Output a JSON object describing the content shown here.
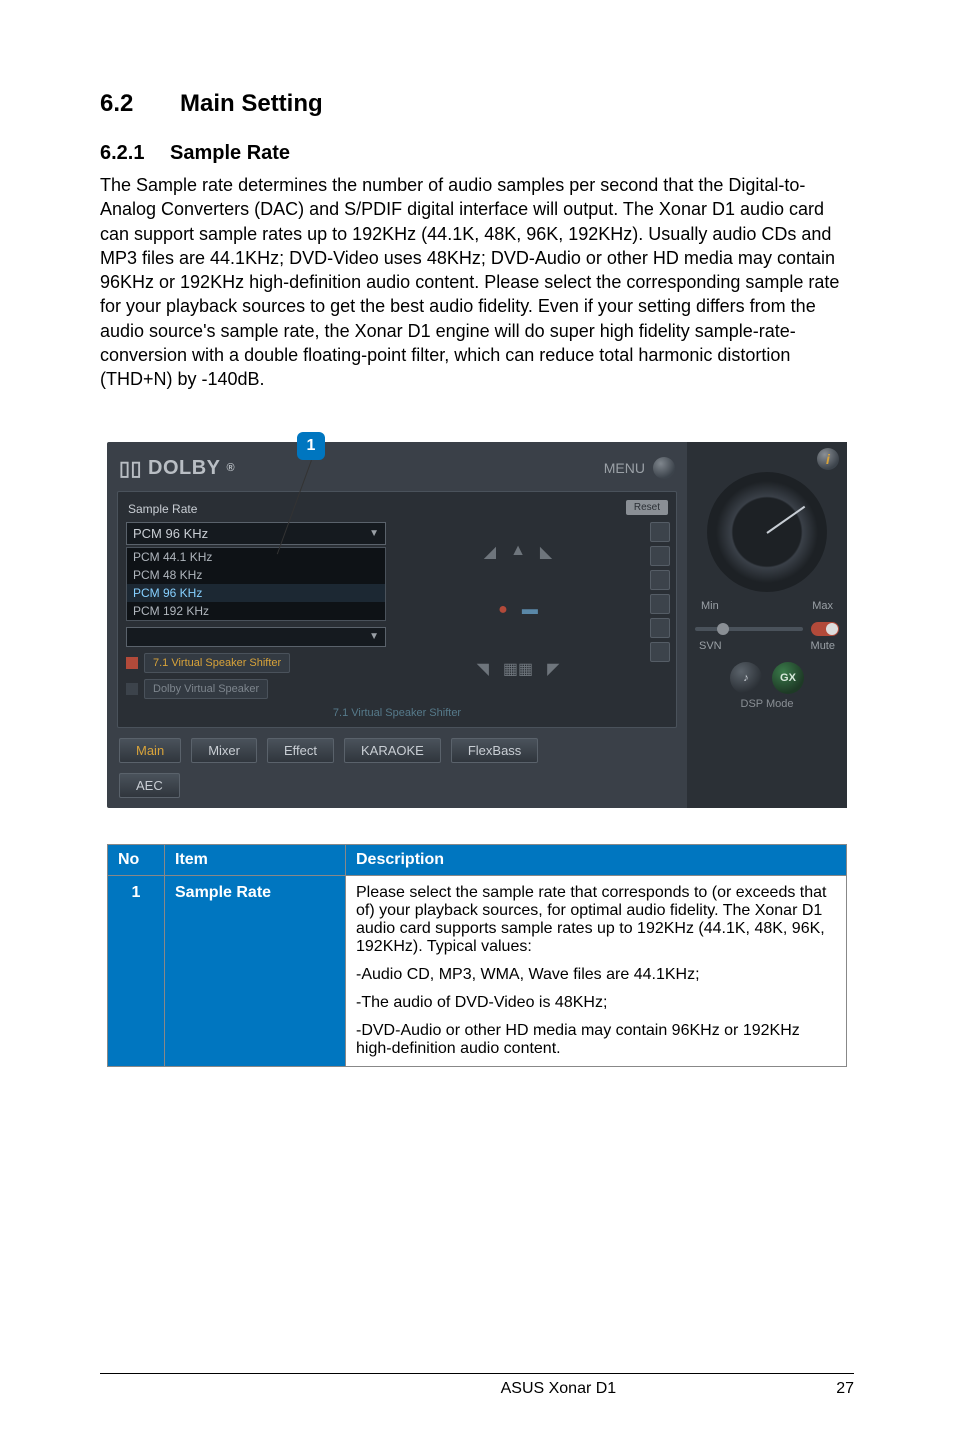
{
  "headings": {
    "h1_num": "6.2",
    "h1_title": "Main Setting",
    "h2_num": "6.2.1",
    "h2_title": "Sample Rate"
  },
  "paragraph": "The Sample rate determines the number of audio samples per second that the Digital-to-Analog Converters (DAC) and S/PDIF digital interface will output. The Xonar D1 audio card can support sample rates up to 192KHz (44.1K, 48K, 96K, 192KHz). Usually audio CDs and MP3 files are 44.1KHz; DVD-Video uses 48KHz; DVD-Audio or other HD media may contain 96KHz or 192KHz high-definition audio content. Please select the corresponding sample rate for your playback sources to get the best audio fidelity. Even if your setting differs from the audio source's sample rate, the Xonar D1 engine will do super high fidelity sample-rate-conversion with a double floating-point filter, which can reduce total harmonic distortion (THD+N) by -140dB.",
  "callout": {
    "badge": "1"
  },
  "shot": {
    "brand": "DOLBY",
    "menu_label": "MENU",
    "reset_label": "Reset",
    "sample_rate_label": "Sample Rate",
    "sample_rate_selected": "PCM 96 KHz",
    "sample_rate_options": [
      "PCM 44.1 KHz",
      "PCM 48 KHz",
      "PCM 96 KHz",
      "PCM 192 KHz"
    ],
    "speaker_buttons": [
      "7.1 Virtual Speaker Shifter",
      "Dolby Virtual Speaker"
    ],
    "panel_footer": "7.1 Virtual Speaker Shifter",
    "tabs": [
      "Main",
      "Mixer",
      "Effect",
      "KARAOKE",
      "FlexBass"
    ],
    "tab_extra": "AEC",
    "side": {
      "info": "i",
      "min": "Min",
      "max": "Max",
      "svn": "SVN",
      "mute": "Mute",
      "dsp_label": "DSP Mode"
    }
  },
  "table": {
    "headers": {
      "no": "No",
      "item": "Item",
      "desc": "Description"
    },
    "row": {
      "no": "1",
      "item": "Sample Rate",
      "desc_p1": "Please select the sample rate that corresponds to (or exceeds that of) your playback sources, for optimal audio fidelity. The Xonar D1 audio card supports sample rates up to 192KHz (44.1K, 48K, 96K, 192KHz). Typical values:",
      "desc_b1": "-Audio CD, MP3, WMA, Wave files are 44.1KHz;",
      "desc_b2": "-The audio of DVD-Video is 48KHz;",
      "desc_b3": "-DVD-Audio or other HD media may contain 96KHz or 192KHz high-definition audio content."
    }
  },
  "footer": {
    "product": "ASUS Xonar D1",
    "page": "27"
  }
}
